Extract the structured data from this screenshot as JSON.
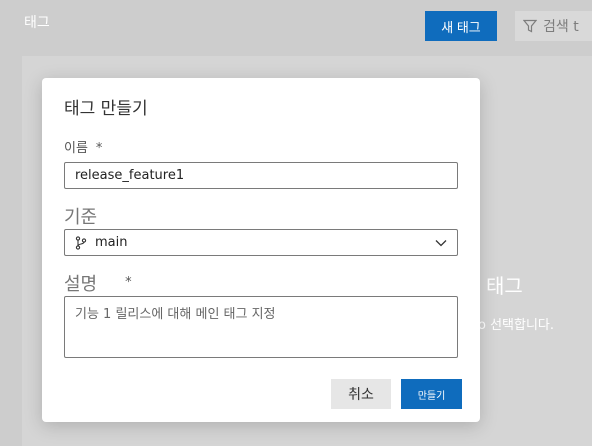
{
  "page": {
    "title": "태그",
    "new_tag_label": "새 태그",
    "search_label": "검색 t",
    "empty_title": "태그",
    "empty_text": "o 선택합니다."
  },
  "dialog": {
    "title": "태그 만들기",
    "name_label": "이름",
    "name_required": "*",
    "name_value": "release_feature1",
    "base_label": "기준",
    "base_value": "main",
    "desc_label": "설명",
    "desc_required": "*",
    "desc_value": "기능 1 릴리스에 대해 메인 태그 지정",
    "cancel_label": "취소",
    "create_label": "만들기"
  },
  "icons": {
    "search": "filter-funnel-icon",
    "branch": "git-branch-icon",
    "dropdown": "chevron-down-icon"
  },
  "colors": {
    "primary": "#0f6cbd",
    "overlay_bg": "#cdcdcd"
  }
}
